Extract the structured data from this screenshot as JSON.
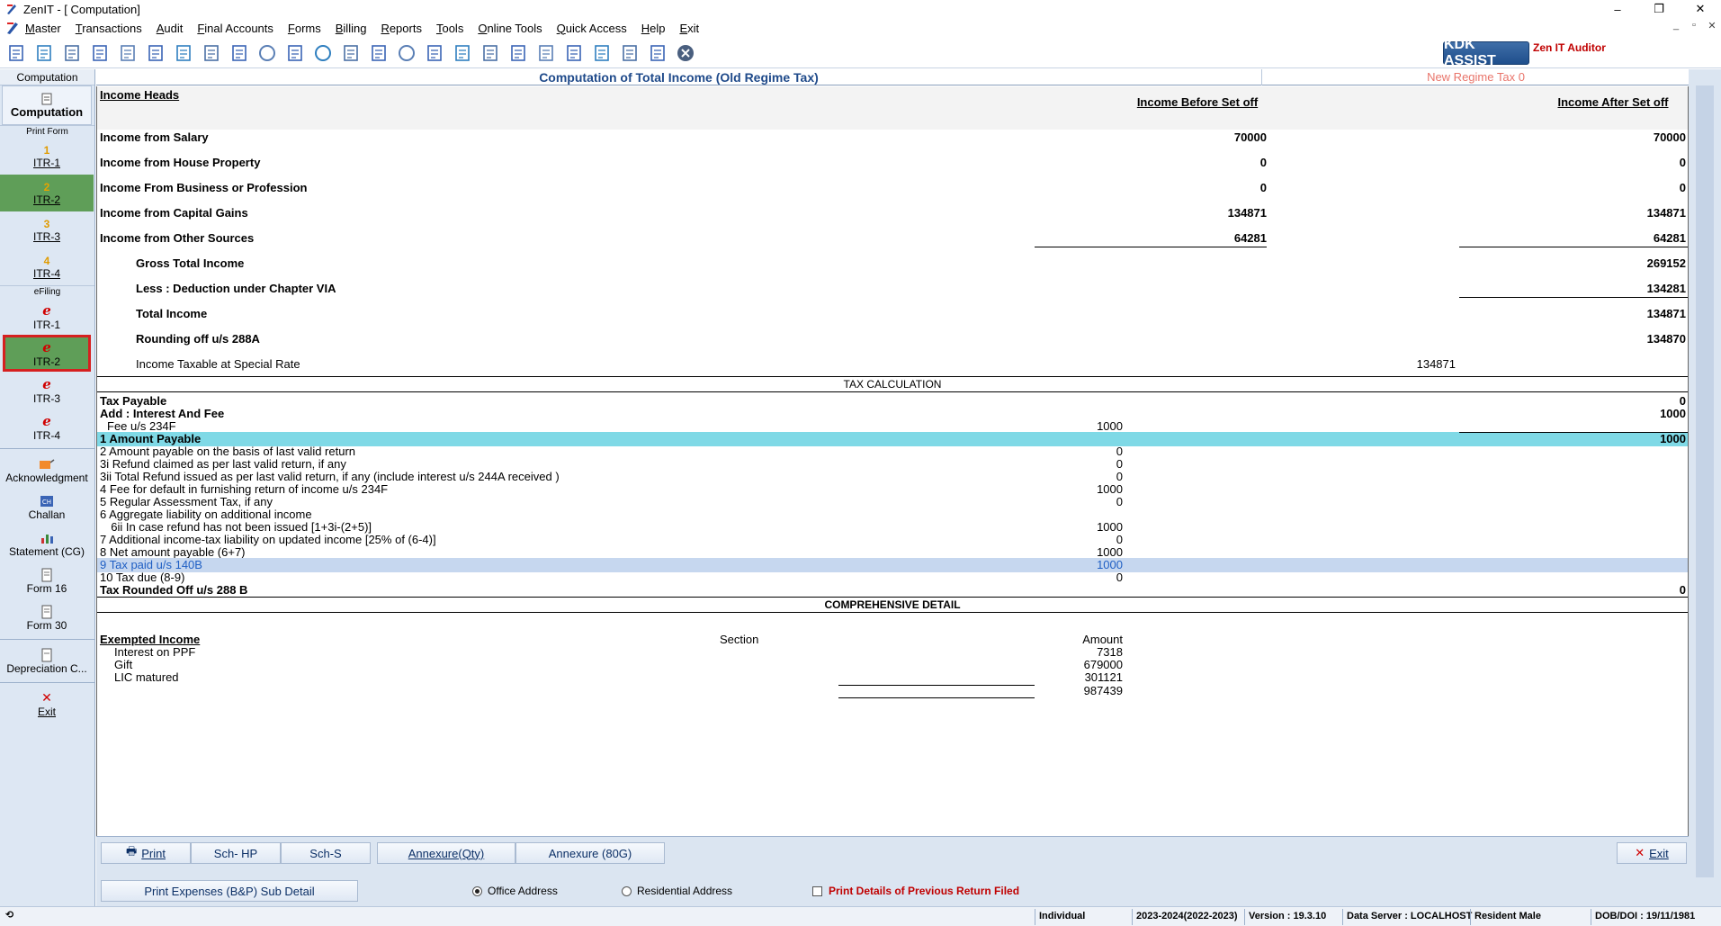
{
  "window": {
    "title": "ZenIT - [ Computation]"
  },
  "menu": [
    "Master",
    "Transactions",
    "Audit",
    "Final Accounts",
    "Forms",
    "Billing",
    "Reports",
    "Tools",
    "Online Tools",
    "Quick Access",
    "Help",
    "Exit"
  ],
  "toolbar": {
    "icons": [
      "computation-icon",
      "home-icon",
      "building-icon",
      "bar-chart-icon",
      "gift-icon",
      "users-icon",
      "gavel-icon",
      "filter-icon",
      "tax-icon",
      "refresh-icon",
      "calculator-icon",
      "pie-chart-icon",
      "pay-icon",
      "book-icon",
      "info-icon",
      "report-icon",
      "form-edit-icon",
      "calendar-icon",
      "upload-icon",
      "download-icon",
      "bs-icon",
      "users-card-icon",
      "scd-icon",
      "calc-sheet-icon",
      "close-circle-icon"
    ],
    "kdk_assist": "KDK ASSIST",
    "zen_auditor": "Zen IT Auditor"
  },
  "sidebar": {
    "header": "Computation",
    "computation_label": "Computation",
    "print_form_label": "Print Form",
    "efiling_label": "eFiling",
    "print_forms": [
      {
        "num": "1",
        "label": "ITR-1"
      },
      {
        "num": "2",
        "label": "ITR-2"
      },
      {
        "num": "3",
        "label": "ITR-3"
      },
      {
        "num": "4",
        "label": "ITR-4"
      }
    ],
    "efiling": [
      {
        "label": "ITR-1"
      },
      {
        "label": "ITR-2"
      },
      {
        "label": "ITR-3"
      },
      {
        "label": "ITR-4"
      }
    ],
    "utilities": [
      {
        "label": "Acknowledgment",
        "icon": "acknowledgment-icon"
      },
      {
        "label": "Challan",
        "icon": "challan-icon"
      },
      {
        "label": "Statement (CG)",
        "icon": "statement-icon"
      },
      {
        "label": "Form 16",
        "icon": "form16-icon"
      },
      {
        "label": "Form 30",
        "icon": "form30-icon"
      },
      {
        "label": "Depreciation C...",
        "icon": "depreciation-icon"
      },
      {
        "label": "Exit",
        "icon": "exit-icon"
      }
    ]
  },
  "header": {
    "old_regime": "Computation of Total Income (Old Regime Tax)",
    "new_regime": "New Regime Tax 0"
  },
  "income": {
    "heads_label": "Income Heads",
    "col_before": "Income Before Set off",
    "col_after": "Income After Set off",
    "rows": [
      {
        "label": "Income from Salary",
        "before": "70000",
        "after": "70000"
      },
      {
        "label": "Income from House Property",
        "before": "0",
        "after": "0"
      },
      {
        "label": "Income From Business or Profession",
        "before": "0",
        "after": "0"
      },
      {
        "label": "Income from Capital Gains",
        "before": "134871",
        "after": "134871"
      },
      {
        "label": "Income from Other Sources",
        "before": "64281",
        "after": "64281"
      }
    ],
    "gross_total_label": "Gross Total Income",
    "gross_total": "269152",
    "deduction_label": "Less : Deduction under Chapter VIA",
    "deduction": "134281",
    "total_income_label": "Total Income",
    "total_income": "134871",
    "rounding_label": "Rounding off u/s 288A",
    "rounding": "134870",
    "special_rate_label": "Income Taxable at Special Rate",
    "special_rate": "134871"
  },
  "tax": {
    "section_title": "TAX CALCULATION",
    "tax_payable_label": "Tax Payable",
    "tax_payable": "0",
    "interest_label": "Add : Interest And Fee",
    "interest": "1000",
    "fee_label": "Fee u/s 234F",
    "fee": "1000",
    "amount_payable_label": "1 Amount Payable",
    "amount_payable": "1000",
    "lines": [
      {
        "label": "2 Amount payable  on the basis of  last valid return",
        "value": "0"
      },
      {
        "label": "3i Refund claimed as per last valid return, if any",
        "value": "0"
      },
      {
        "label": "3ii Total Refund issued as per last valid return, if any (include interest u/s 244A received )",
        "value": "0"
      },
      {
        "label": "4 Fee for default in furnishing return of income u/s 234F",
        "value": "1000"
      },
      {
        "label": "5 Regular Assessment Tax, if any",
        "value": "0"
      },
      {
        "label": "6 Aggregate liability on additional income",
        "value": ""
      },
      {
        "label": "  6ii In case refund has not been issued [1+3i-(2+5)]",
        "value": "1000"
      },
      {
        "label": "7 Additional income-tax liability on updated income [25% of (6-4)]",
        "value": "0"
      },
      {
        "label": "8 Net amount payable (6+7)",
        "value": "1000"
      },
      {
        "label": "9 Tax paid u/s 140B",
        "value": "1000"
      },
      {
        "label": "10 Tax due (8-9)",
        "value": "0"
      }
    ],
    "rounded_label": "Tax Rounded Off u/s 288 B",
    "rounded": "0"
  },
  "comprehensive": {
    "title": "COMPREHENSIVE DETAIL",
    "exempted_label": "Exempted Income",
    "section_col": "Section",
    "amount_col": "Amount",
    "items": [
      {
        "label": "Interest on PPF",
        "amount": "7318"
      },
      {
        "label": "Gift",
        "amount": "679000"
      },
      {
        "label": "LIC matured",
        "amount": "301121"
      }
    ],
    "total": "987439"
  },
  "bottom": {
    "print": "Print",
    "sch_hp": "Sch- HP",
    "sch_s": "Sch-S",
    "annexure_qty": "Annexure(Qty)",
    "annexure_80g": "Annexure (80G)",
    "exit": "Exit",
    "print_expenses": "Print Expenses (B&P) Sub Detail",
    "office_address": "Office Address",
    "residential_address": "Residential Address",
    "print_prev": "Print Details of Previous Return Filed"
  },
  "status": {
    "type": "Individual",
    "ay": "2023-2024(2022-2023)",
    "version": "Version : 19.3.10",
    "server": "Data Server : LOCALHOST",
    "resident": "Resident Male",
    "dob": "DOB/DOI : 19/11/1981"
  },
  "colors": {
    "accent": "#1f4a8a",
    "selected_green": "#5f9e58",
    "cyan_row": "#7fd9e6",
    "blue_row": "#c6d7ef",
    "red_outline": "#d62020"
  }
}
